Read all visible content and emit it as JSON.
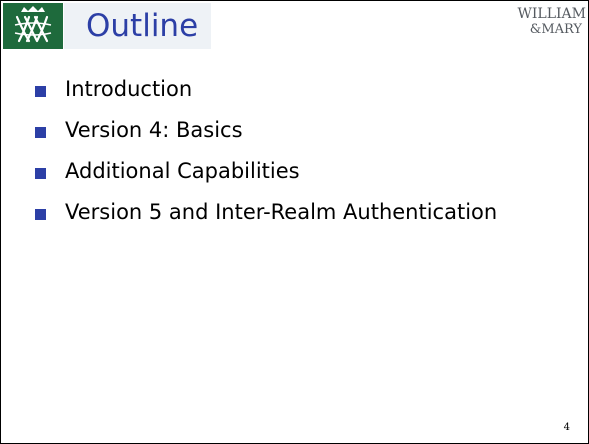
{
  "slide": {
    "logo_icon": "cypher-shield-icon",
    "title": "Outline",
    "wordmark": {
      "line1": "WILLIAM",
      "line2": "&MARY"
    },
    "bullets": [
      "Introduction",
      "Version 4: Basics",
      "Additional Capabilities",
      "Version 5 and Inter-Realm Authentication"
    ],
    "page_number": "4"
  },
  "colors": {
    "title": "#2c3fa6",
    "bullet_marker": "#2c3fa6",
    "logo_background": "#1e6a3c",
    "title_background": "#eef2f6",
    "wordmark": "#555a60"
  }
}
